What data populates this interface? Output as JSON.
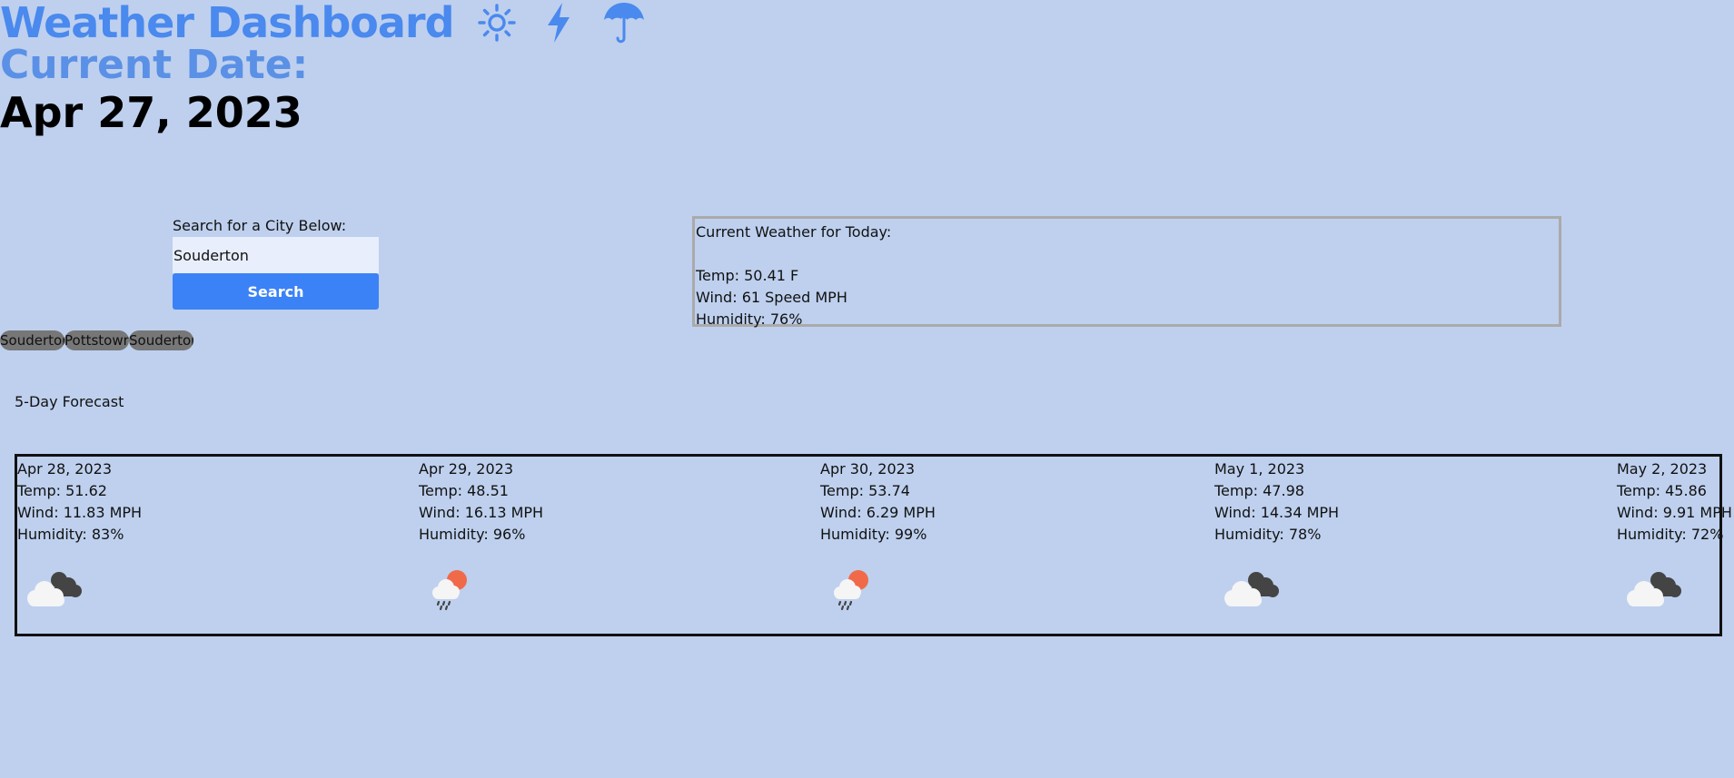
{
  "header": {
    "title": "Weather Dashboard",
    "icons": [
      "sun-icon",
      "lightning-icon",
      "umbrella-icon"
    ],
    "current_date_label": "Current Date:",
    "current_date": "Apr 27, 2023"
  },
  "search": {
    "label": "Search for a City Below:",
    "value": "Souderton",
    "button_label": "Search"
  },
  "history": [
    "Souderton",
    "Pottstown",
    "Souderton"
  ],
  "current": {
    "title": "Current Weather for Today:",
    "temp": "Temp: 50.41 F",
    "wind": "Wind: 61 Speed MPH",
    "humidity": "Humidity: 76%"
  },
  "forecast": {
    "label": "5-Day Forecast",
    "days": [
      {
        "date": "Apr 28, 2023",
        "temp": "Temp: 51.62",
        "wind": "Wind: 11.83 MPH",
        "humidity": "Humidity: 83%",
        "icon": "overcast-clouds-icon"
      },
      {
        "date": "Apr 29, 2023",
        "temp": "Temp: 48.51",
        "wind": "Wind: 16.13 MPH",
        "humidity": "Humidity: 96%",
        "icon": "rain-sun-icon"
      },
      {
        "date": "Apr 30, 2023",
        "temp": "Temp: 53.74",
        "wind": "Wind: 6.29 MPH",
        "humidity": "Humidity: 99%",
        "icon": "rain-sun-icon"
      },
      {
        "date": "May 1, 2023",
        "temp": "Temp: 47.98",
        "wind": "Wind: 14.34 MPH",
        "humidity": "Humidity: 78%",
        "icon": "overcast-clouds-icon"
      },
      {
        "date": "May 2, 2023",
        "temp": "Temp: 45.86",
        "wind": "Wind: 9.91 MPH",
        "humidity": "Humidity: 72%",
        "icon": "overcast-clouds-icon"
      }
    ]
  },
  "colors": {
    "background": "#bed0ee",
    "title": "#4a89ee",
    "button": "#3b82f6",
    "history_button": "#777777"
  }
}
